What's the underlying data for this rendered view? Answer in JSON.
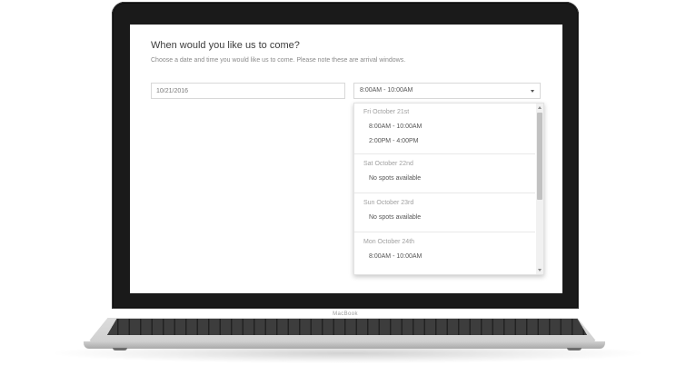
{
  "device": {
    "brand_label": "MacBook"
  },
  "form": {
    "heading": "When would you like us to come?",
    "subheading": "Choose a date and time you would like us to come. Please note these are arrival windows.",
    "date_value": "10/21/2016",
    "time_selected": "8:00AM - 10:00AM"
  },
  "dropdown": {
    "groups": [
      {
        "label": "Fri October 21st",
        "options": [
          "8:00AM - 10:00AM",
          "2:00PM - 4:00PM"
        ]
      },
      {
        "label": "Sat October 22nd",
        "options": [
          "No spots available"
        ]
      },
      {
        "label": "Sun October 23rd",
        "options": [
          "No spots available"
        ]
      },
      {
        "label": "Mon October 24th",
        "options": [
          "8:00AM - 10:00AM"
        ]
      }
    ]
  },
  "icons": {
    "select_caret": "chevron-down-icon",
    "scroll_up": "arrow-up-icon",
    "scroll_down": "arrow-down-icon"
  }
}
